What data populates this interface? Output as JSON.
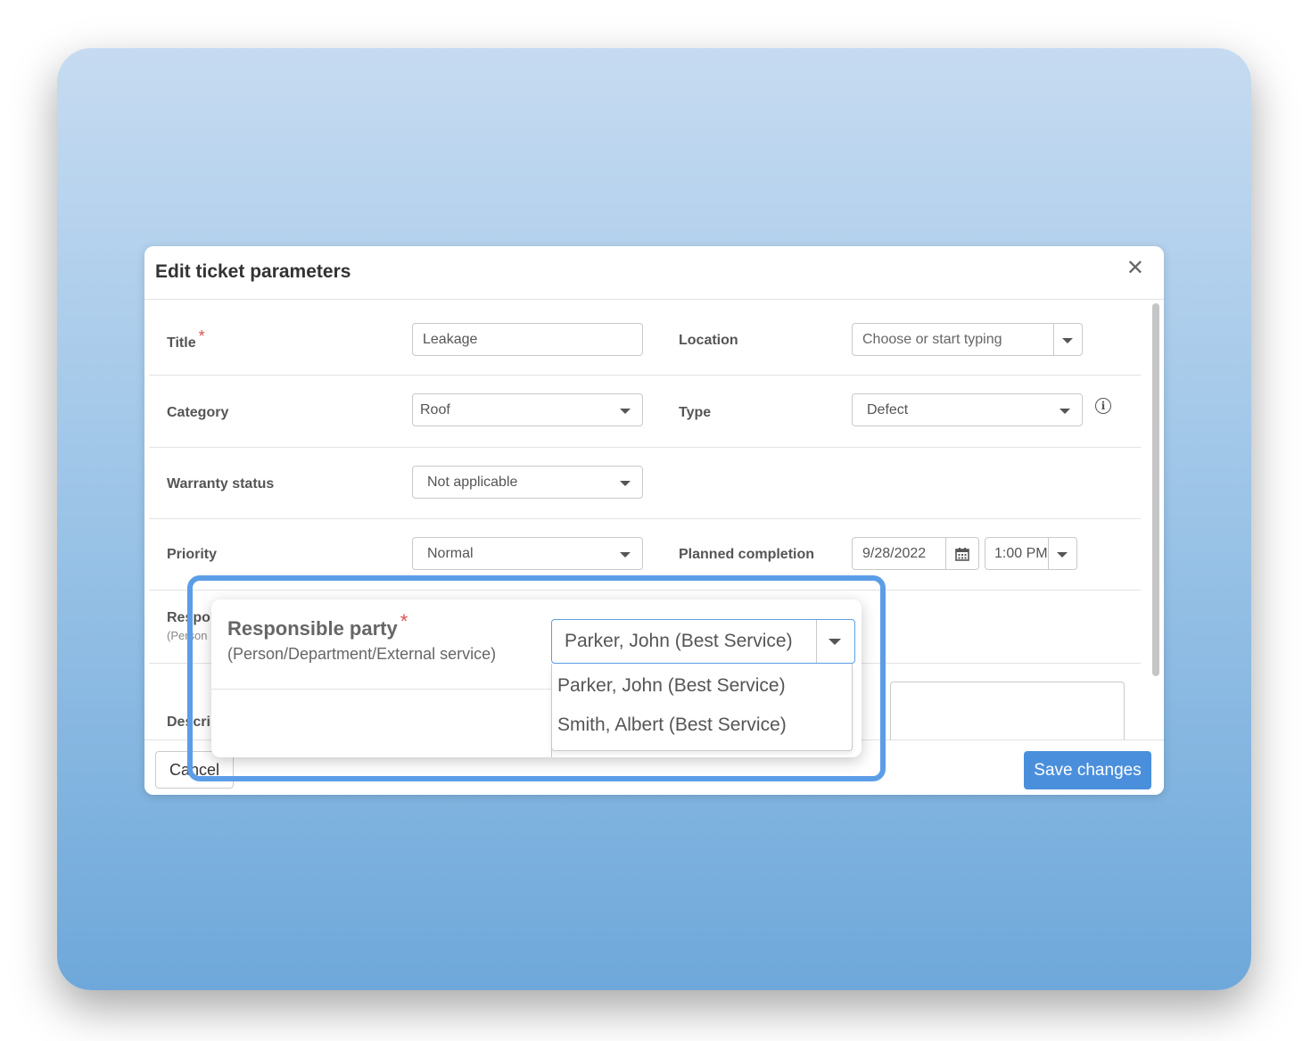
{
  "modal": {
    "title": "Edit ticket parameters",
    "close_glyph": "✕"
  },
  "fields": {
    "title_label": "Title",
    "title_value": "Leakage",
    "location_label": "Location",
    "location_placeholder": "Choose or start typing",
    "category_label": "Category",
    "category_value": "Roof",
    "type_label": "Type",
    "type_value": "Defect",
    "warranty_label": "Warranty status",
    "warranty_value": "Not applicable",
    "priority_label": "Priority",
    "priority_value": "Normal",
    "planned_label": "Planned completion",
    "planned_date": "9/28/2022",
    "planned_time": "1:00 PM",
    "responsible_label_partial": "Respo",
    "responsible_sub_partial": "(Person",
    "description_label_partial": "Descri"
  },
  "required_mark": "*",
  "info_glyph": "i",
  "footer": {
    "cancel_label": "Cancel",
    "save_label": "Save changes"
  },
  "zoom": {
    "label": "Responsible party",
    "sublabel": "(Person/Department/External service)",
    "selected": "Parker, John (Best Service)",
    "options": [
      "Parker, John (Best Service)",
      "Smith, Albert (Best Service)"
    ]
  },
  "colors": {
    "accent": "#4a8fdc",
    "highlight": "#5c9de8",
    "required": "#d9534f"
  }
}
